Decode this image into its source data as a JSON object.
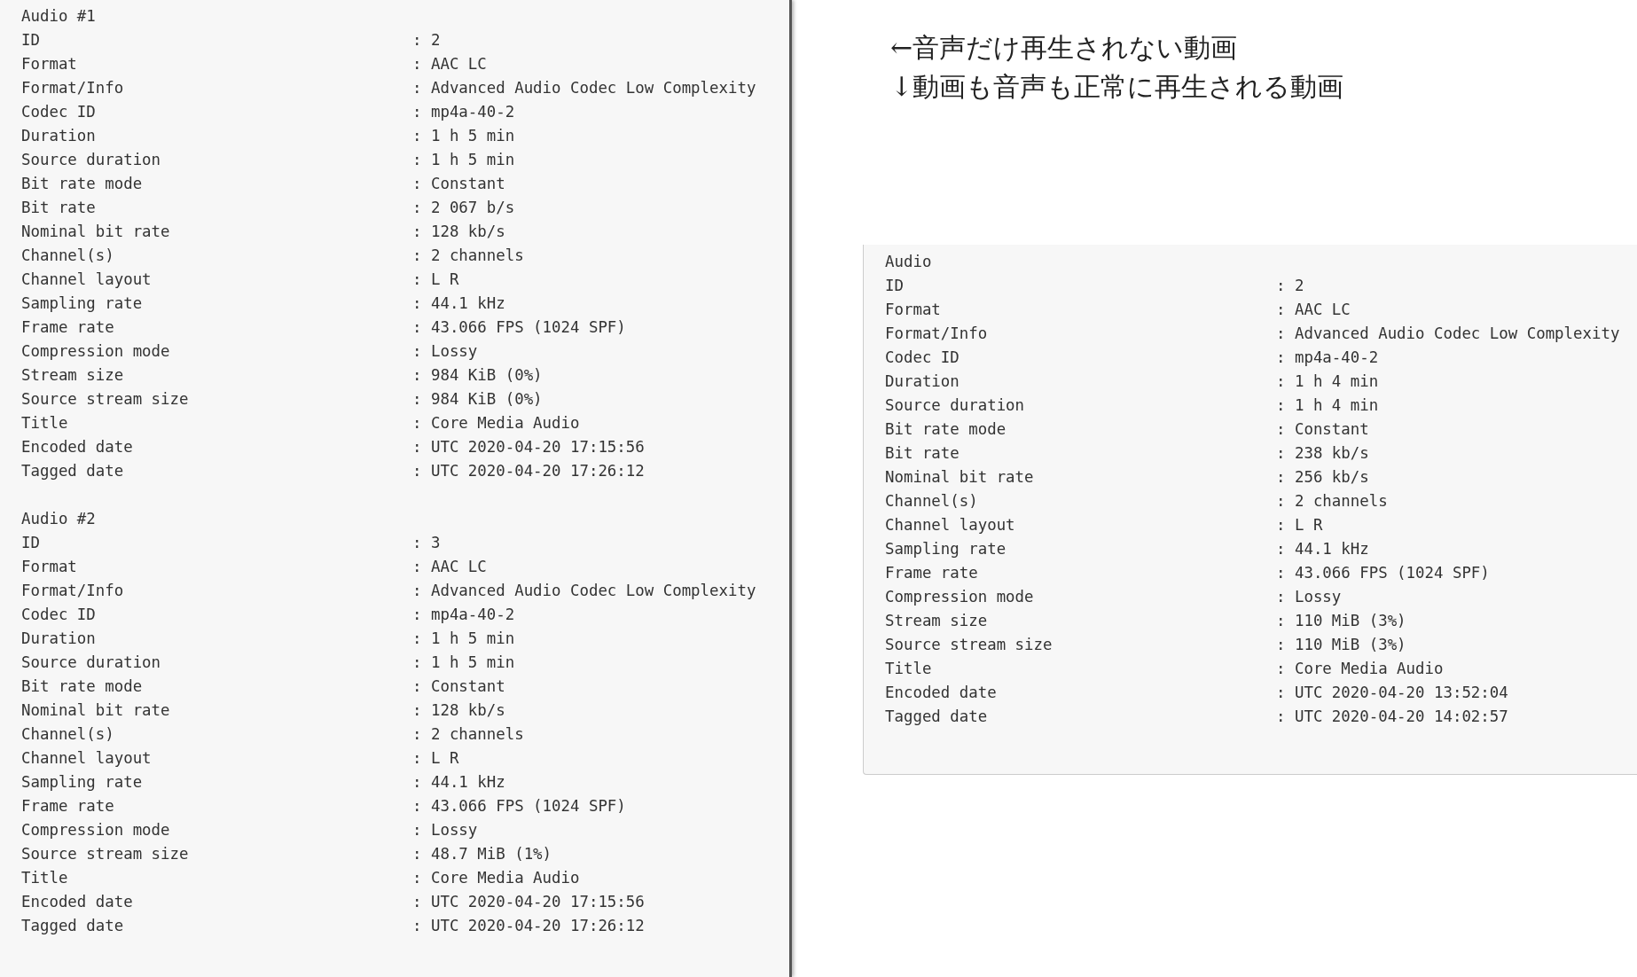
{
  "left_panel": {
    "sections": [
      {
        "heading": "Audio #1",
        "rows": [
          {
            "label": "ID",
            "value": ": 2"
          },
          {
            "label": "Format",
            "value": ": AAC LC"
          },
          {
            "label": "Format/Info",
            "value": ": Advanced Audio Codec Low Complexity"
          },
          {
            "label": "Codec ID",
            "value": ": mp4a-40-2"
          },
          {
            "label": "Duration",
            "value": ": 1 h 5 min"
          },
          {
            "label": "Source duration",
            "value": ": 1 h 5 min"
          },
          {
            "label": "Bit rate mode",
            "value": ": Constant"
          },
          {
            "label": "Bit rate",
            "value": ": 2 067 b/s"
          },
          {
            "label": "Nominal bit rate",
            "value": ": 128 kb/s"
          },
          {
            "label": "Channel(s)",
            "value": ": 2 channels"
          },
          {
            "label": "Channel layout",
            "value": ": L R"
          },
          {
            "label": "Sampling rate",
            "value": ": 44.1 kHz"
          },
          {
            "label": "Frame rate",
            "value": ": 43.066 FPS (1024 SPF)"
          },
          {
            "label": "Compression mode",
            "value": ": Lossy"
          },
          {
            "label": "Stream size",
            "value": ": 984 KiB (0%)"
          },
          {
            "label": "Source stream size",
            "value": ": 984 KiB (0%)"
          },
          {
            "label": "Title",
            "value": ": Core Media Audio"
          },
          {
            "label": "Encoded date",
            "value": ": UTC 2020-04-20 17:15:56"
          },
          {
            "label": "Tagged date",
            "value": ": UTC 2020-04-20 17:26:12"
          }
        ]
      },
      {
        "heading": "Audio #2",
        "rows": [
          {
            "label": "ID",
            "value": ": 3"
          },
          {
            "label": "Format",
            "value": ": AAC LC"
          },
          {
            "label": "Format/Info",
            "value": ": Advanced Audio Codec Low Complexity"
          },
          {
            "label": "Codec ID",
            "value": ": mp4a-40-2"
          },
          {
            "label": "Duration",
            "value": ": 1 h 5 min"
          },
          {
            "label": "Source duration",
            "value": ": 1 h 5 min"
          },
          {
            "label": "Bit rate mode",
            "value": ": Constant"
          },
          {
            "label": "Nominal bit rate",
            "value": ": 128 kb/s"
          },
          {
            "label": "Channel(s)",
            "value": ": 2 channels"
          },
          {
            "label": "Channel layout",
            "value": ": L R"
          },
          {
            "label": "Sampling rate",
            "value": ": 44.1 kHz"
          },
          {
            "label": "Frame rate",
            "value": ": 43.066 FPS (1024 SPF)"
          },
          {
            "label": "Compression mode",
            "value": ": Lossy"
          },
          {
            "label": "Source stream size",
            "value": ": 48.7 MiB (1%)"
          },
          {
            "label": "Title",
            "value": ": Core Media Audio"
          },
          {
            "label": "Encoded date",
            "value": ": UTC 2020-04-20 17:15:56"
          },
          {
            "label": "Tagged date",
            "value": ": UTC 2020-04-20 17:26:12"
          }
        ]
      }
    ]
  },
  "notes": [
    "←音声だけ再生されない動画",
    "↓動画も音声も正常に再生される動画"
  ],
  "right_panel": {
    "sections": [
      {
        "heading": "Audio",
        "rows": [
          {
            "label": "ID",
            "value": ": 2"
          },
          {
            "label": "Format",
            "value": ": AAC LC"
          },
          {
            "label": "Format/Info",
            "value": ": Advanced Audio Codec Low Complexity"
          },
          {
            "label": "Codec ID",
            "value": ": mp4a-40-2"
          },
          {
            "label": "Duration",
            "value": ": 1 h 4 min"
          },
          {
            "label": "Source duration",
            "value": ": 1 h 4 min"
          },
          {
            "label": "Bit rate mode",
            "value": ": Constant"
          },
          {
            "label": "Bit rate",
            "value": ": 238 kb/s"
          },
          {
            "label": "Nominal bit rate",
            "value": ": 256 kb/s"
          },
          {
            "label": "Channel(s)",
            "value": ": 2 channels"
          },
          {
            "label": "Channel layout",
            "value": ": L R"
          },
          {
            "label": "Sampling rate",
            "value": ": 44.1 kHz"
          },
          {
            "label": "Frame rate",
            "value": ": 43.066 FPS (1024 SPF)"
          },
          {
            "label": "Compression mode",
            "value": ": Lossy"
          },
          {
            "label": "Stream size",
            "value": ": 110 MiB (3%)"
          },
          {
            "label": "Source stream size",
            "value": ": 110 MiB (3%)"
          },
          {
            "label": "Title",
            "value": ": Core Media Audio"
          },
          {
            "label": "Encoded date",
            "value": ": UTC 2020-04-20 13:52:04"
          },
          {
            "label": "Tagged date",
            "value": ": UTC 2020-04-20 14:02:57"
          }
        ]
      }
    ]
  }
}
